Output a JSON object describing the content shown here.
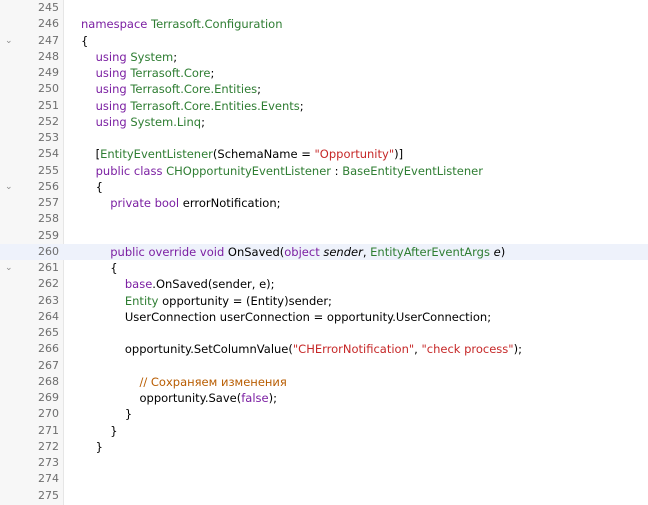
{
  "editor": {
    "current_line": "260",
    "lines": [
      {
        "num": "245",
        "fold": "",
        "tokens": []
      },
      {
        "num": "246",
        "fold": "",
        "tokens": [
          {
            "t": "namespace ",
            "c": "kw"
          },
          {
            "t": "Terrasoft.Configuration",
            "c": "ty"
          }
        ]
      },
      {
        "num": "247",
        "fold": "⌄",
        "tokens": [
          {
            "t": "{",
            "c": ""
          }
        ]
      },
      {
        "num": "248",
        "fold": "",
        "tokens": [
          {
            "t": "    ",
            "c": ""
          },
          {
            "t": "using ",
            "c": "kw"
          },
          {
            "t": "System",
            "c": "ty"
          },
          {
            "t": ";",
            "c": ""
          }
        ]
      },
      {
        "num": "249",
        "fold": "",
        "tokens": [
          {
            "t": "    ",
            "c": ""
          },
          {
            "t": "using ",
            "c": "kw"
          },
          {
            "t": "Terrasoft.Core",
            "c": "ty"
          },
          {
            "t": ";",
            "c": ""
          }
        ]
      },
      {
        "num": "250",
        "fold": "",
        "tokens": [
          {
            "t": "    ",
            "c": ""
          },
          {
            "t": "using ",
            "c": "kw"
          },
          {
            "t": "Terrasoft.Core.Entities",
            "c": "ty"
          },
          {
            "t": ";",
            "c": ""
          }
        ]
      },
      {
        "num": "251",
        "fold": "",
        "tokens": [
          {
            "t": "    ",
            "c": ""
          },
          {
            "t": "using ",
            "c": "kw"
          },
          {
            "t": "Terrasoft.Core.Entities.Events",
            "c": "ty"
          },
          {
            "t": ";",
            "c": ""
          }
        ]
      },
      {
        "num": "252",
        "fold": "",
        "tokens": [
          {
            "t": "    ",
            "c": ""
          },
          {
            "t": "using ",
            "c": "kw"
          },
          {
            "t": "System.Linq",
            "c": "ty"
          },
          {
            "t": ";",
            "c": ""
          }
        ]
      },
      {
        "num": "253",
        "fold": "",
        "tokens": []
      },
      {
        "num": "254",
        "fold": "",
        "tokens": [
          {
            "t": "    [",
            "c": ""
          },
          {
            "t": "EntityEventListener",
            "c": "ty"
          },
          {
            "t": "(SchemaName = ",
            "c": ""
          },
          {
            "t": "\"Opportunity\"",
            "c": "st"
          },
          {
            "t": ")]",
            "c": ""
          }
        ]
      },
      {
        "num": "255",
        "fold": "",
        "tokens": [
          {
            "t": "    ",
            "c": ""
          },
          {
            "t": "public class ",
            "c": "kw"
          },
          {
            "t": "CHOpportunityEventListener",
            "c": "ty"
          },
          {
            "t": " : ",
            "c": ""
          },
          {
            "t": "BaseEntityEventListener",
            "c": "ty"
          }
        ]
      },
      {
        "num": "256",
        "fold": "⌄",
        "tokens": [
          {
            "t": "    {",
            "c": ""
          }
        ]
      },
      {
        "num": "257",
        "fold": "",
        "tokens": [
          {
            "t": "        ",
            "c": ""
          },
          {
            "t": "private bool ",
            "c": "kw"
          },
          {
            "t": "errorNotification;",
            "c": ""
          }
        ]
      },
      {
        "num": "258",
        "fold": "",
        "tokens": []
      },
      {
        "num": "259",
        "fold": "",
        "tokens": []
      },
      {
        "num": "260",
        "fold": "",
        "tokens": [
          {
            "t": "        ",
            "c": ""
          },
          {
            "t": "public override void ",
            "c": "kw"
          },
          {
            "t": "OnSaved(",
            "c": ""
          },
          {
            "t": "object ",
            "c": "kw"
          },
          {
            "t": "sender",
            "c": "it"
          },
          {
            "t": ", ",
            "c": ""
          },
          {
            "t": "EntityAfterEventArgs ",
            "c": "ty"
          },
          {
            "t": "e",
            "c": "it"
          },
          {
            "t": ")",
            "c": ""
          }
        ]
      },
      {
        "num": "261",
        "fold": "⌄",
        "tokens": [
          {
            "t": "        {",
            "c": ""
          }
        ]
      },
      {
        "num": "262",
        "fold": "",
        "tokens": [
          {
            "t": "            ",
            "c": ""
          },
          {
            "t": "base",
            "c": "kw"
          },
          {
            "t": ".OnSaved(sender, e);",
            "c": ""
          }
        ]
      },
      {
        "num": "263",
        "fold": "",
        "tokens": [
          {
            "t": "            ",
            "c": ""
          },
          {
            "t": "Entity ",
            "c": "ty"
          },
          {
            "t": "opportunity = (Entity)sender;",
            "c": ""
          }
        ]
      },
      {
        "num": "264",
        "fold": "",
        "tokens": [
          {
            "t": "            UserConnection userConnection = opportunity.UserConnection;",
            "c": ""
          }
        ]
      },
      {
        "num": "265",
        "fold": "",
        "tokens": []
      },
      {
        "num": "266",
        "fold": "",
        "tokens": [
          {
            "t": "            opportunity.SetColumnValue(",
            "c": ""
          },
          {
            "t": "\"CHErrorNotification\"",
            "c": "st"
          },
          {
            "t": ", ",
            "c": ""
          },
          {
            "t": "\"check process\"",
            "c": "st"
          },
          {
            "t": ");",
            "c": ""
          }
        ]
      },
      {
        "num": "267",
        "fold": "",
        "tokens": []
      },
      {
        "num": "268",
        "fold": "",
        "tokens": [
          {
            "t": "                ",
            "c": ""
          },
          {
            "t": "// Сохраняем изменения",
            "c": "cm"
          }
        ]
      },
      {
        "num": "269",
        "fold": "",
        "tokens": [
          {
            "t": "                opportunity.Save(",
            "c": ""
          },
          {
            "t": "false",
            "c": "kw"
          },
          {
            "t": ");",
            "c": ""
          }
        ]
      },
      {
        "num": "270",
        "fold": "",
        "tokens": [
          {
            "t": "            }",
            "c": ""
          }
        ]
      },
      {
        "num": "271",
        "fold": "",
        "tokens": [
          {
            "t": "        }",
            "c": ""
          }
        ]
      },
      {
        "num": "272",
        "fold": "",
        "tokens": [
          {
            "t": "    }",
            "c": ""
          }
        ]
      },
      {
        "num": "273",
        "fold": "",
        "tokens": []
      },
      {
        "num": "274",
        "fold": "",
        "tokens": []
      },
      {
        "num": "275",
        "fold": "",
        "tokens": []
      }
    ]
  }
}
